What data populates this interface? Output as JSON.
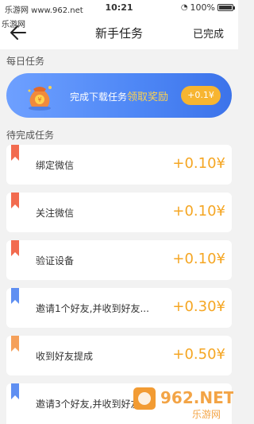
{
  "statusbar": {
    "carrier": "乐游网 www.962.net",
    "time": "10:21",
    "battery": "100%"
  },
  "watermark_top": "乐游网",
  "nav": {
    "title": "新手任务",
    "done": "已完成"
  },
  "daily": {
    "section": "每日任务",
    "text": "完成下载任务",
    "highlight": "领取奖励",
    "pill": "+0.1¥"
  },
  "pending": {
    "section": "待完成任务",
    "tasks": [
      {
        "label": "绑定微信",
        "reward": "+0.10¥",
        "flag_color": "#f26b4f"
      },
      {
        "label": "关注微信",
        "reward": "+0.10¥",
        "flag_color": "#f26b4f"
      },
      {
        "label": "验证设备",
        "reward": "+0.10¥",
        "flag_color": "#f26b4f"
      },
      {
        "label": "邀请1个好友,并收到好友...",
        "reward": "+0.30¥",
        "flag_color": "#5f8ff2"
      },
      {
        "label": "收到好友提成",
        "reward": "+0.50¥",
        "flag_color": "#f5a05a"
      },
      {
        "label": "邀请3个好友,并收到好友...",
        "reward": "",
        "flag_color": "#5f8ff2"
      }
    ]
  },
  "watermark": {
    "brand": "962.NET",
    "site": "乐游网"
  }
}
